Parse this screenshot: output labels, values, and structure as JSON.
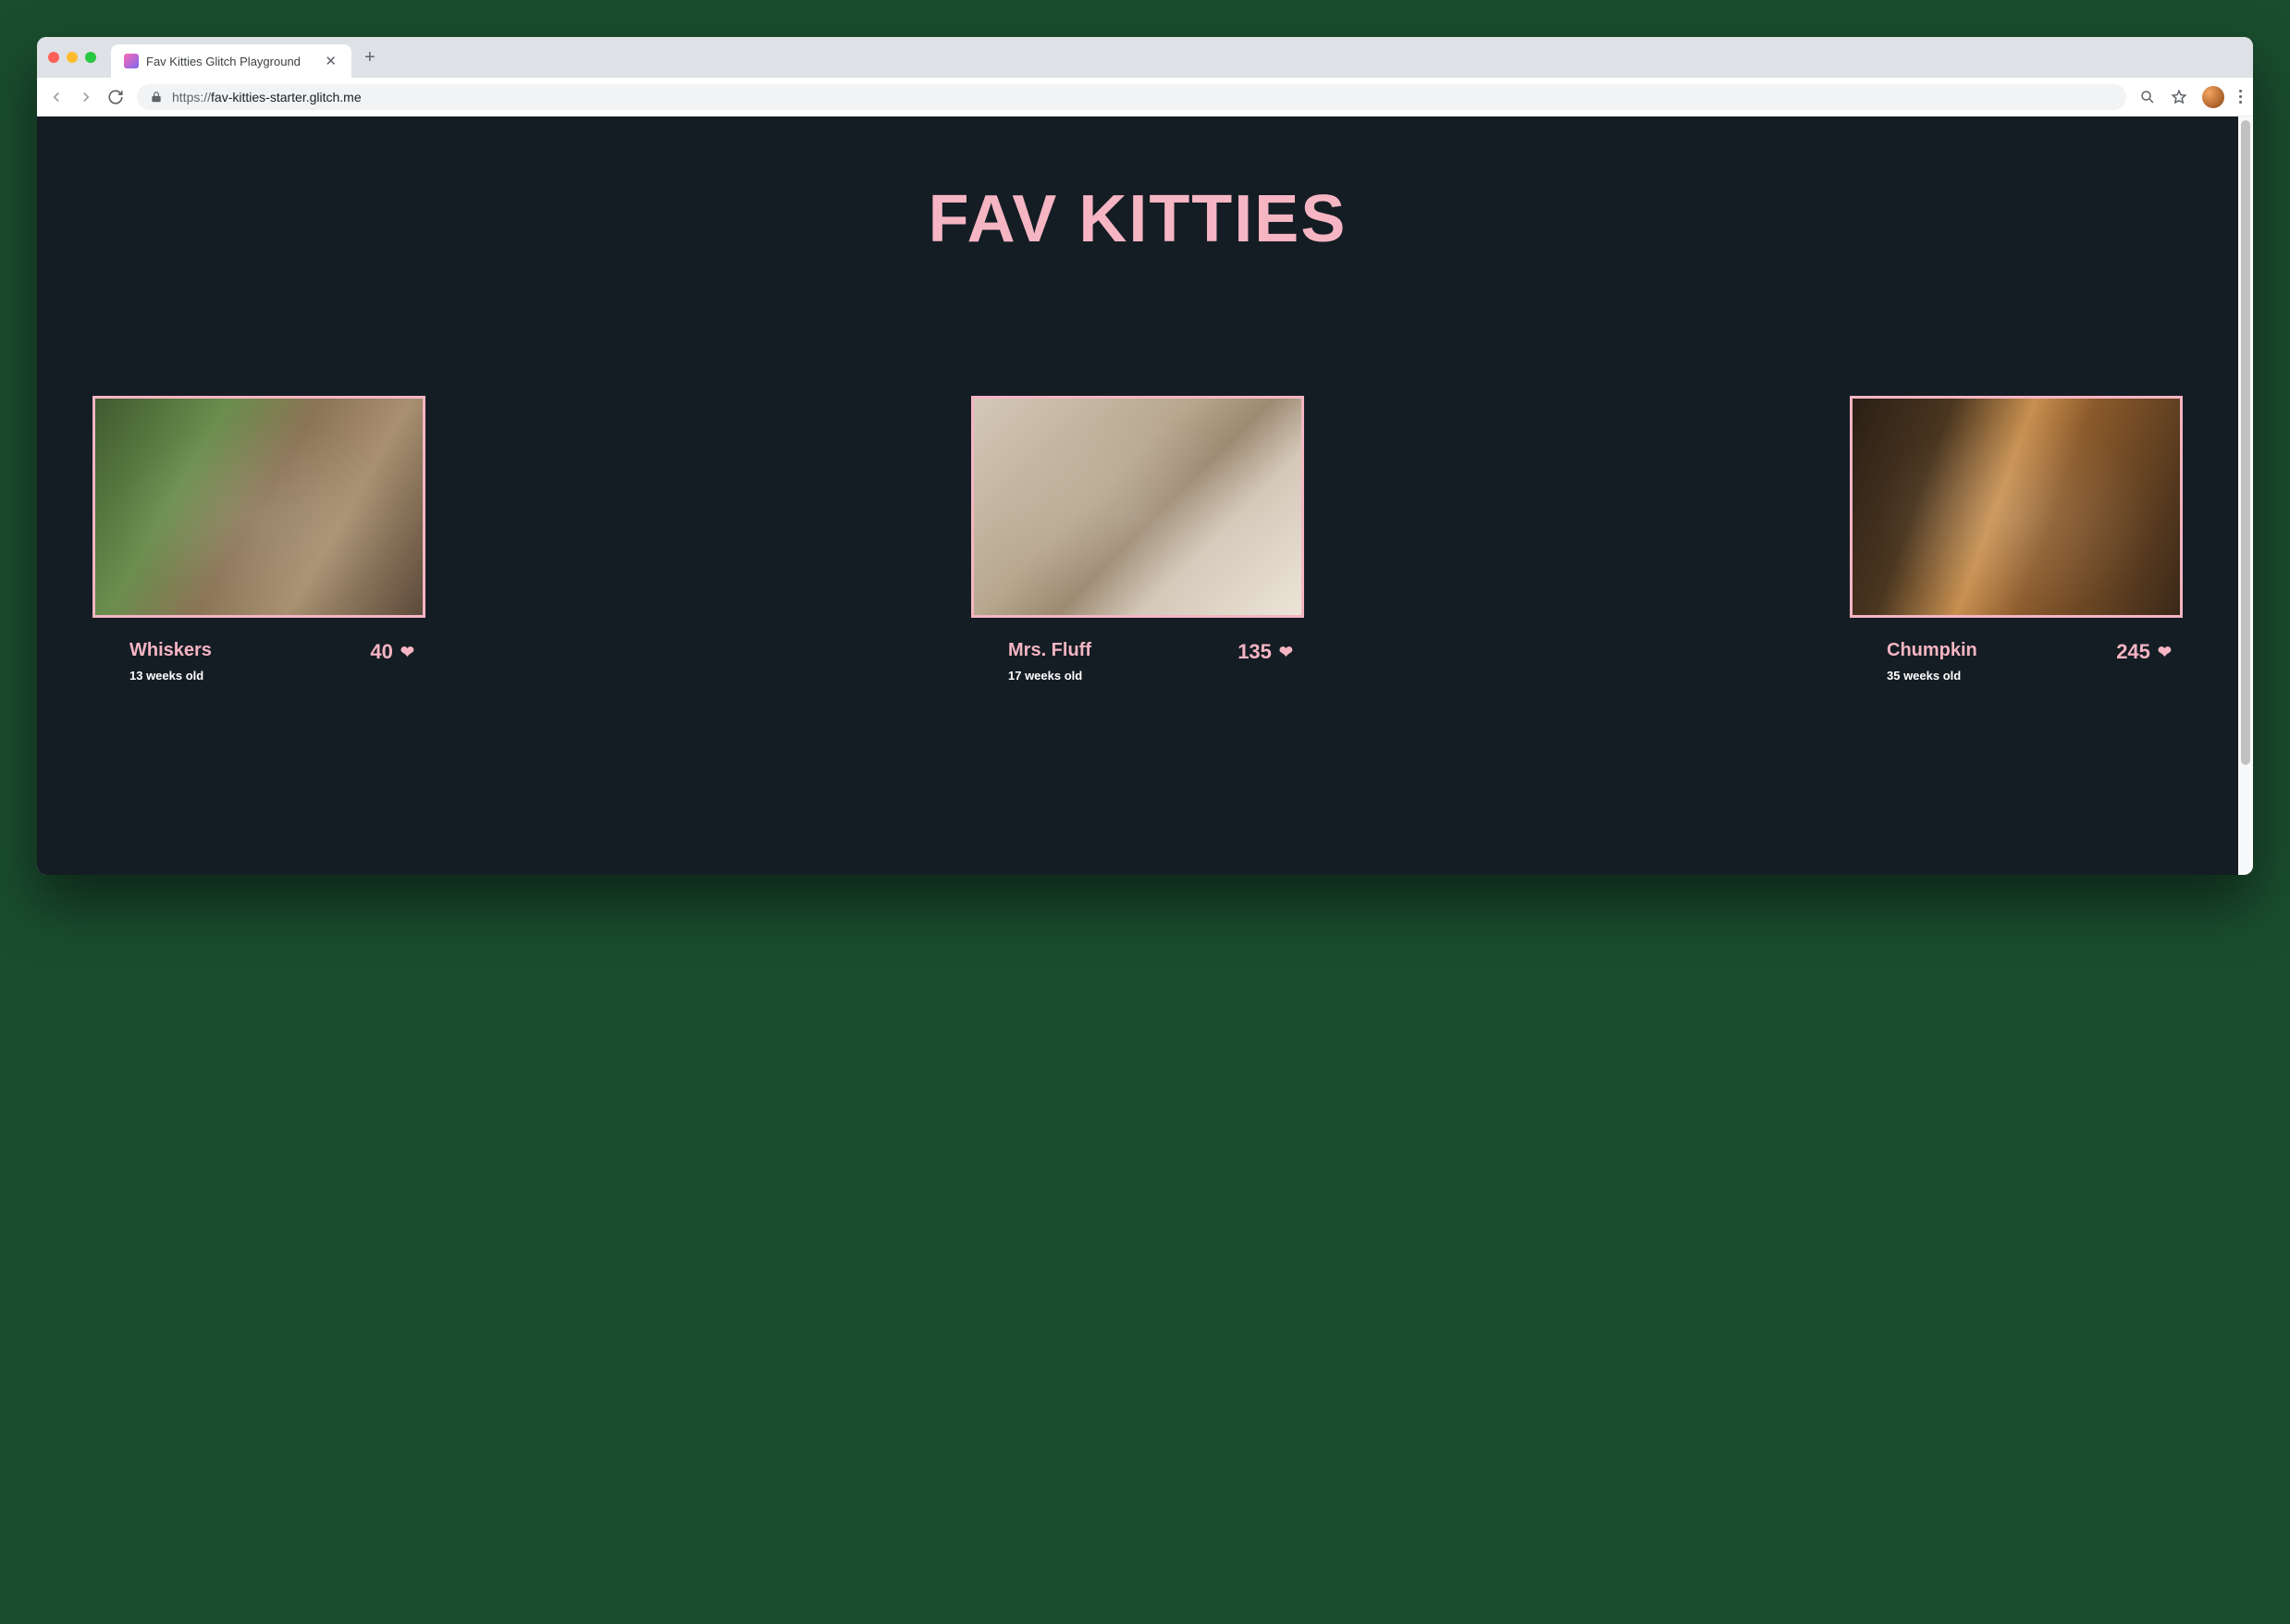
{
  "browser": {
    "tab_title": "Fav Kitties Glitch Playground",
    "url_prefix": "https://",
    "url_host_path": "fav-kitties-starter.glitch.me"
  },
  "page": {
    "title": "FAV KITTIES"
  },
  "cats": [
    {
      "name": "Whiskers",
      "age": "13 weeks old",
      "likes": "40"
    },
    {
      "name": "Mrs. Fluff",
      "age": "17 weeks old",
      "likes": "135"
    },
    {
      "name": "Chumpkin",
      "age": "35 weeks old",
      "likes": "245"
    }
  ],
  "colors": {
    "accent": "#f5b5c3",
    "page_bg": "#151d24"
  }
}
